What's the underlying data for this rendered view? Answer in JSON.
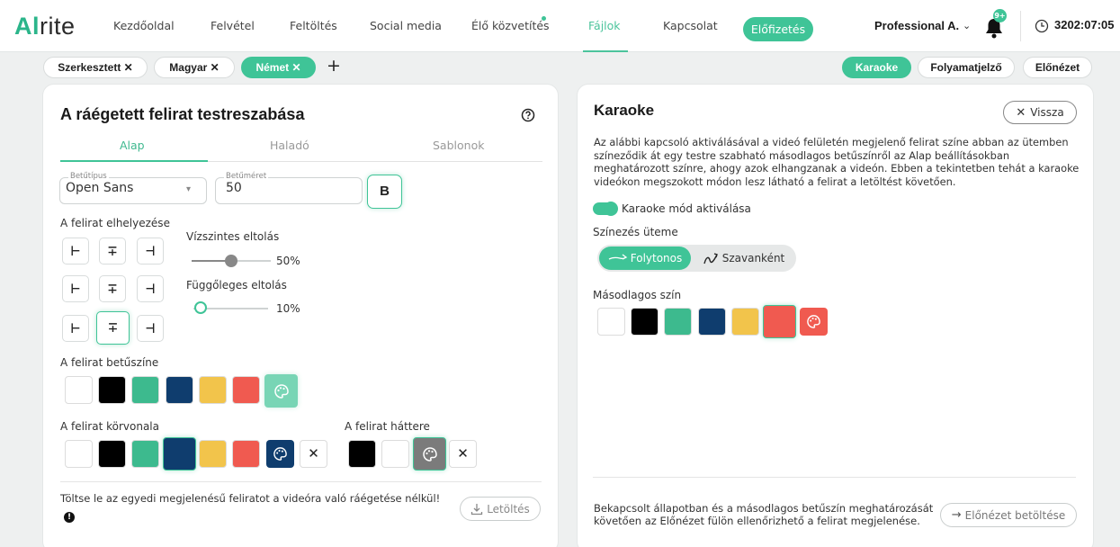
{
  "app": {
    "logo_prefix": "Al",
    "logo_suffix": "rite"
  },
  "nav": {
    "items": [
      "Kezdőoldal",
      "Felvétel",
      "Feltöltés",
      "Social media",
      "Élő közvetítés",
      "Fájlok",
      "Kapcsolat"
    ],
    "active": "Fájlok",
    "subscribe": "Előfizetés",
    "user": "Professional A.",
    "notification_badge": "9+",
    "timer": "3202:07:05"
  },
  "chips": {
    "left": [
      "Szerkesztett ✕",
      "Magyar ✕",
      "Német ✕"
    ],
    "plus": "+",
    "right": [
      "Karaoke",
      "Folyamatjelző",
      "Előnézet"
    ]
  },
  "left_panel": {
    "title": "A ráégetett felirat testreszabása",
    "tabs": [
      "Alap",
      "Haladó",
      "Sablonok"
    ],
    "font_label": "Betűtípus",
    "font_value": "Open Sans",
    "size_label": "Betűméret",
    "size_value": "50",
    "bold_label": "B",
    "position_label": "A felirat elhelyezése",
    "horizontal_label": "Vízszintes eltolás",
    "horizontal_value": "50%",
    "horizontal_fraction": 0.5,
    "vertical_label": "Függőleges eltolás",
    "vertical_value": "10%",
    "vertical_fraction": 0.1,
    "text_color_label": "A felirat betűszíne",
    "outline_label": "A felirat körvonala",
    "background_label": "A felirat háttere",
    "swatch_colors": [
      "#ffffff",
      "#000000",
      "#3dba8e",
      "#0f3d6e",
      "#f2c44b",
      "#f05a50"
    ],
    "footer_text": "Töltse le az egyedi megjelenésű feliratot a videóra való ráégetése nélkül!",
    "download": "Letöltés"
  },
  "right_panel": {
    "title": "Karaoke",
    "back": "Vissza",
    "description": "Az alábbi kapcsoló aktiválásával a videó felületén megjelenő felirat színe abban az ütemben színeződik át egy testre szabható másodlagos betűszínről az Alap beállításokban meghatározott színre, ahogy azok elhangzanak a videón. Ebben a tekintetben tehát a karaoke videókon megszokott módon lesz látható a felirat a letöltést követően.",
    "toggle_label": "Karaoke mód aktiválása",
    "rhythm_label": "Színezés üteme",
    "rhythm_options": [
      "Folytonos",
      "Szavanként"
    ],
    "secondary_label": "Másodlagos szín",
    "footer_text": "Bekapcsolt állapotban és a másodlagos betűszín meghatározását követően az Előnézet fülön ellenőrizhető a felirat megjelenése.",
    "preview_button": "Előnézet betöltése"
  }
}
